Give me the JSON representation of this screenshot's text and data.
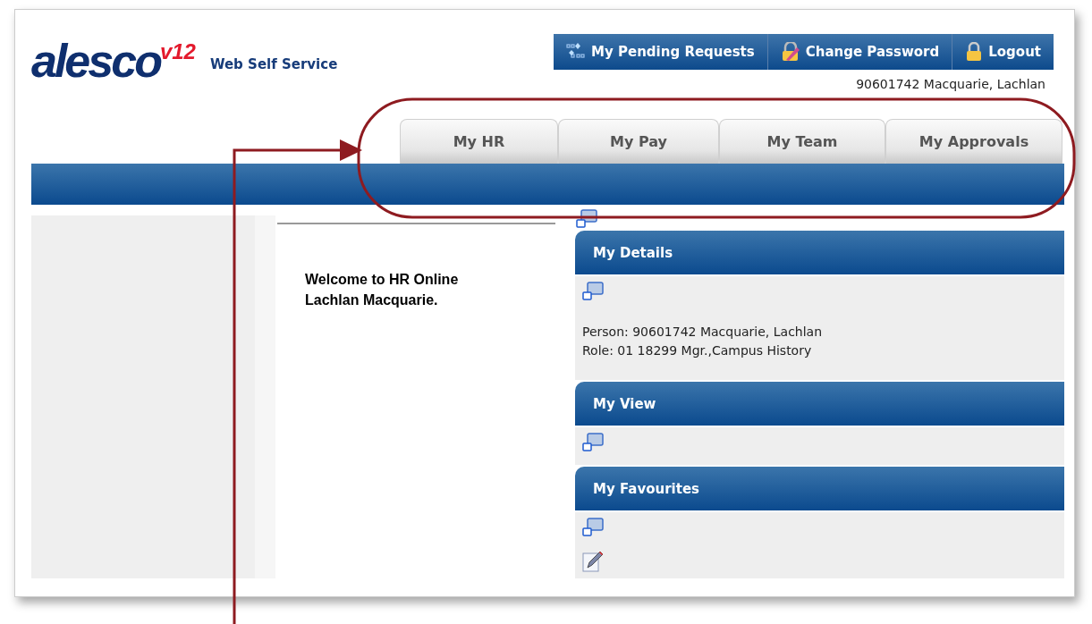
{
  "logo": {
    "name": "alesco",
    "version": "v12",
    "subtitle": "Web Self Service"
  },
  "top_buttons": [
    {
      "kind": "pending",
      "label": "My Pending Requests"
    },
    {
      "kind": "password",
      "label": "Change Password"
    },
    {
      "kind": "lock",
      "label": "Logout"
    }
  ],
  "user": "90601742 Macquarie, Lachlan",
  "tabs": [
    {
      "label": "My HR",
      "selected": false
    },
    {
      "label": "My Pay",
      "selected": false
    },
    {
      "label": "My Team",
      "selected": false
    },
    {
      "label": "My Approvals",
      "selected": false
    }
  ],
  "welcome": [
    "Welcome to HR Online",
    "Lachlan Macquarie."
  ],
  "panels": [
    {
      "title": "My Details",
      "items": [
        {
          "kind": "window"
        },
        {
          "kind": "text",
          "lines": [
            "Person: 90601742 Macquarie, Lachlan",
            "Role: 01 18299 Mgr.,Campus History"
          ]
        }
      ]
    },
    {
      "title": "My View",
      "items": [
        {
          "kind": "window"
        }
      ]
    },
    {
      "title": "My Favourites",
      "items": [
        {
          "kind": "window"
        },
        {
          "kind": "pencil"
        }
      ]
    }
  ]
}
